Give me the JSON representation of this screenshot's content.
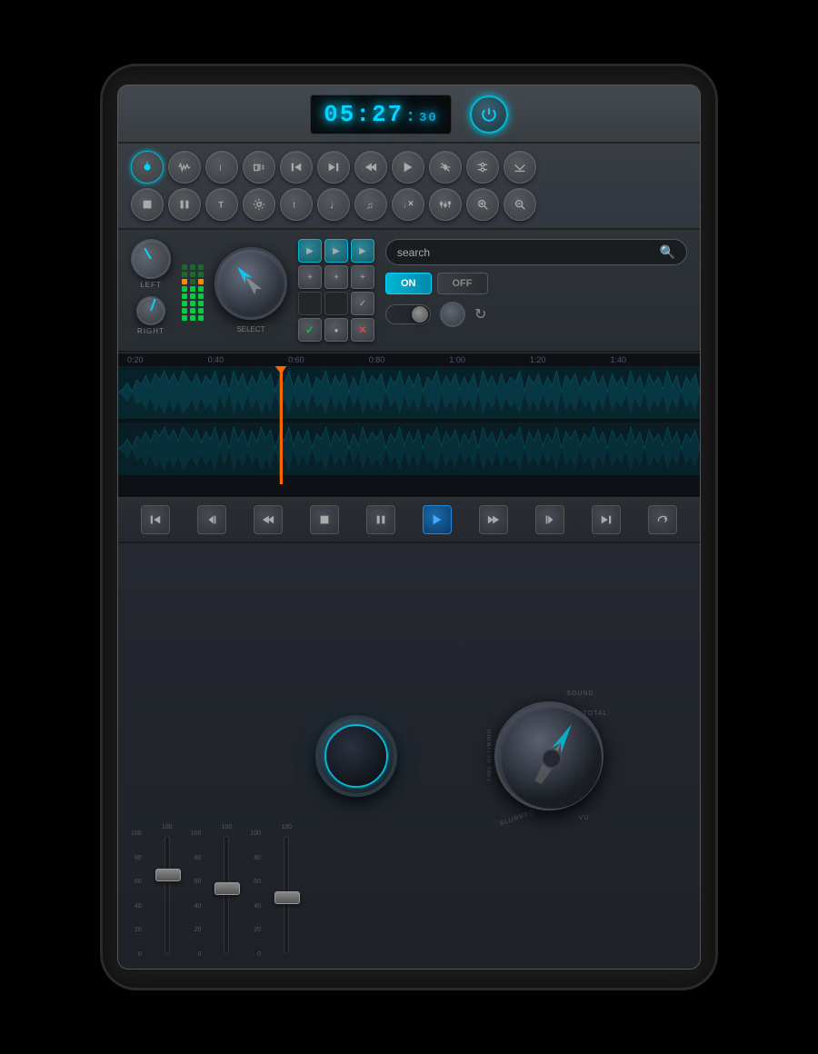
{
  "display": {
    "time_main": "05:27",
    "time_sub": "30",
    "power_label": "Power"
  },
  "search": {
    "placeholder": "search",
    "value": "search"
  },
  "toggle": {
    "on_label": "ON",
    "off_label": "OFF"
  },
  "knobs": {
    "left_label": "LEFT",
    "right_label": "RIGHT",
    "select_label": "SELECT"
  },
  "timeline": {
    "marks": [
      "0:20",
      "0:40",
      "0:60",
      "0:80",
      "1:00",
      "1:20",
      "1:40"
    ]
  },
  "faders": {
    "scales": [
      "100",
      "80",
      "60",
      "40",
      "20",
      "0"
    ],
    "channels": [
      {
        "label": "",
        "position": 35
      },
      {
        "label": "",
        "position": 45
      },
      {
        "label": "",
        "position": 55
      }
    ]
  },
  "speed_knob": {
    "labels": {
      "sound": "SOUND",
      "total": "TOTAL",
      "vu": "VU",
      "slurred": "SLURRED",
      "time_retiming": "TIME RETIMING"
    }
  },
  "buttons": {
    "row1": [
      "⏮",
      "⏩",
      "ℹ",
      "⏱",
      "⏮",
      "⏭",
      "◀",
      "▶",
      "⚡",
      "⇌",
      "⬇"
    ],
    "row2": [
      "⏹",
      "⏸",
      "T",
      "⚙",
      "t",
      "♩",
      "♫",
      "⚡",
      "⚖",
      "🔍+",
      "🔍-"
    ]
  },
  "transport": {
    "buttons": [
      "⏮",
      "⏮",
      "◀◀",
      "⏹",
      "⏸",
      "▶",
      "⏩",
      "⏭",
      "⏭",
      "↺"
    ]
  }
}
